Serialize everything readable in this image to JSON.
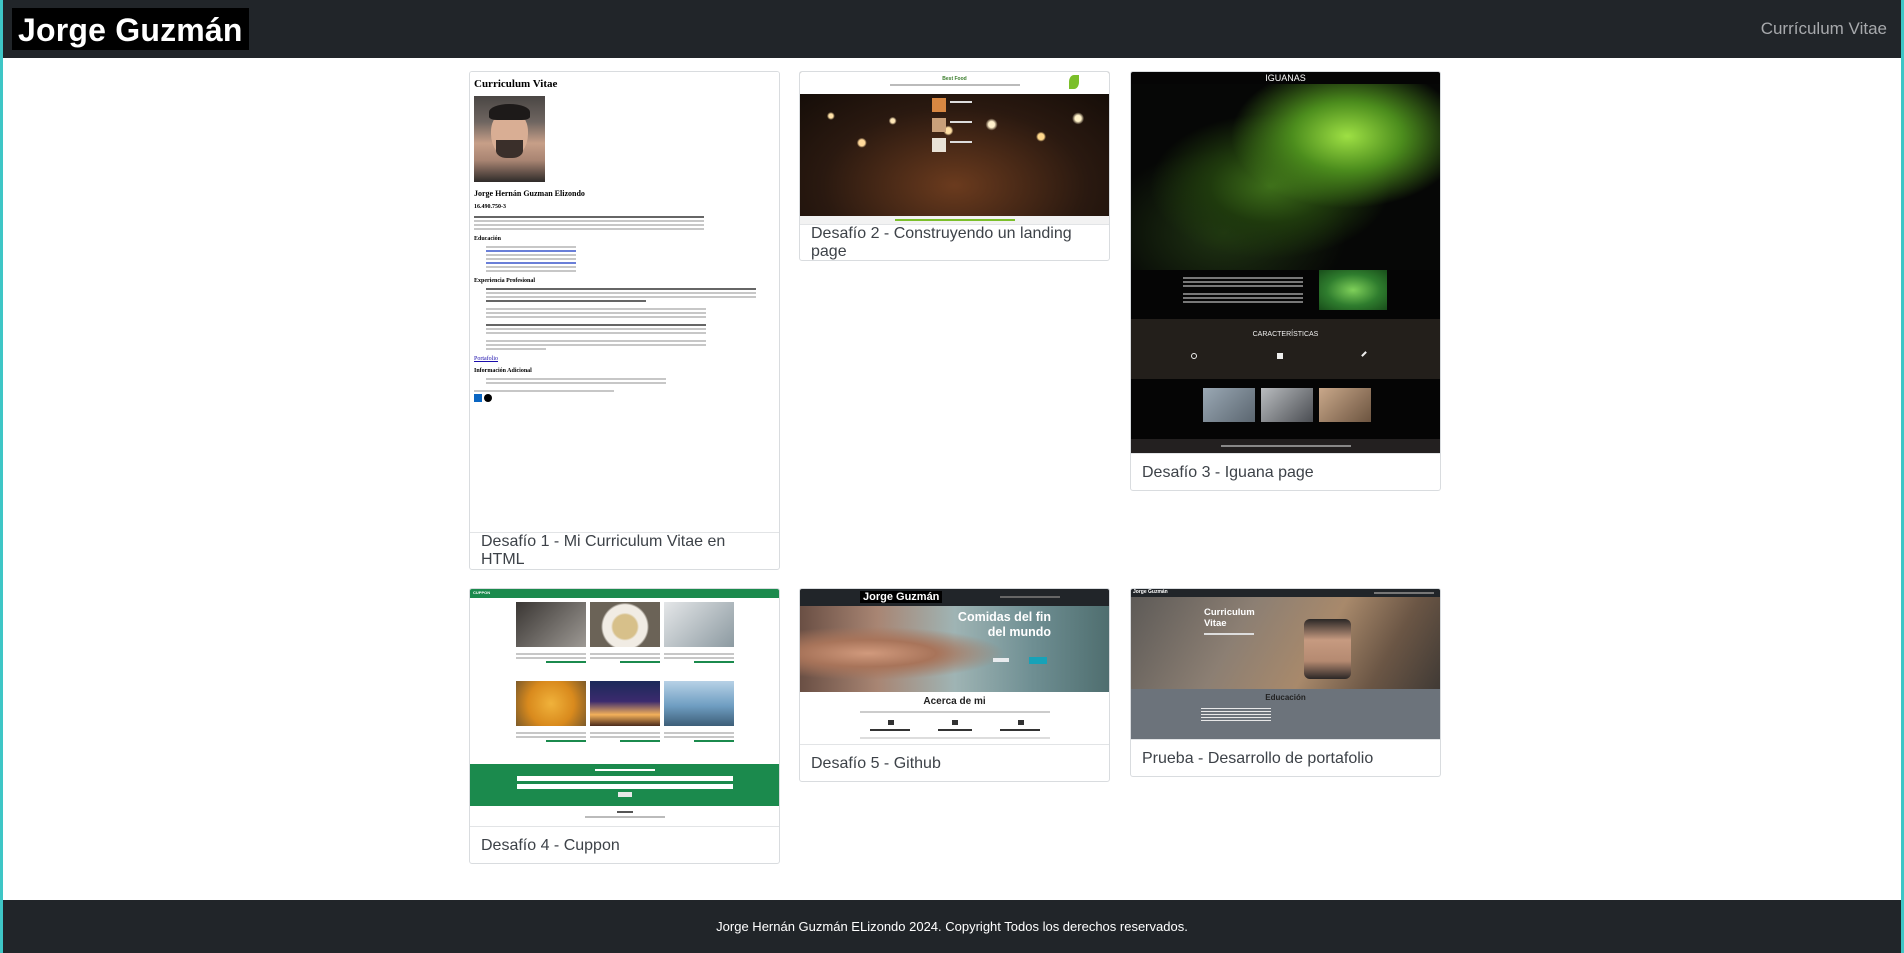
{
  "navbar": {
    "brand": "Jorge Guzmán",
    "link": "Currículum Vitae"
  },
  "cards": [
    {
      "caption": "Desafío 1 - Mi Curriculum Vitae en HTML",
      "thumb": {
        "title": "Curriculum Vitae",
        "name": "Jorge Hernán Guzman Elizondo",
        "rut": "16.490.750-3",
        "sections": [
          "Educación",
          "Experiencia Profesional",
          "Portafolio",
          "Información Adicional"
        ]
      }
    },
    {
      "caption": "Desafío 2 - Construyendo un landing page",
      "thumb": {
        "title": "Best Food"
      }
    },
    {
      "caption": "Desafío 3 - Iguana page",
      "thumb": {
        "title": "IGUANAS",
        "band_title": "CARACTERÍSTICAS"
      }
    },
    {
      "caption": "Desafío 4 - Cuppon",
      "thumb": {
        "title": "CUPPON"
      }
    },
    {
      "caption": "Desafío 5 - Github",
      "thumb": {
        "brand": "Jorge Guzmán",
        "hero_line1": "Comidas del fin",
        "hero_line2": "del mundo",
        "about": "Acerca de mi"
      }
    },
    {
      "caption": "Prueba - Desarrollo de portafolio",
      "thumb": {
        "brand": "Jorge Guzmán",
        "hero_line1": "Curriculum",
        "hero_line2": "Vitae",
        "section": "Educación"
      }
    }
  ],
  "footer": {
    "text": "Jorge Hernán Guzmán ELizondo 2024. Copyright Todos los derechos reservados."
  }
}
